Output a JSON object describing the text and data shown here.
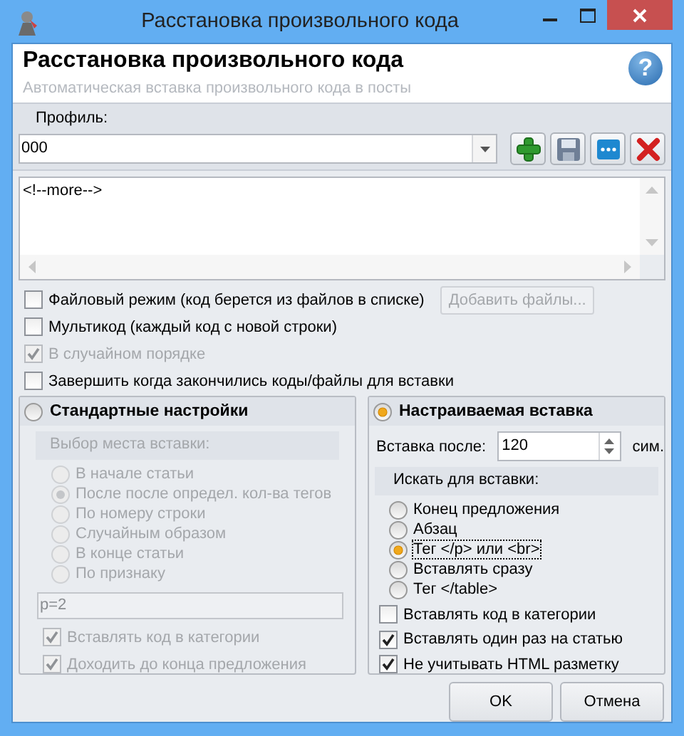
{
  "window": {
    "title": "Расстановка произвольного кода"
  },
  "header": {
    "title": "Расстановка произвольного кода",
    "subtitle": "Автоматическая вставка произвольного кода в посты",
    "help": "?"
  },
  "profile": {
    "label": "Профиль:",
    "value": "000",
    "buttons": [
      {
        "kind": "add"
      },
      {
        "kind": "save"
      },
      {
        "kind": "more"
      },
      {
        "kind": "delete"
      }
    ]
  },
  "code_editor": {
    "text": "<!--more-->"
  },
  "options": [
    {
      "label": "Файловый режим (код берется из файлов в списке)",
      "checked": false,
      "disabled": false,
      "button": {
        "label": "Добавить файлы...",
        "disabled": true
      }
    },
    {
      "label": "Мультикод (каждый код с новой строки)",
      "checked": false,
      "disabled": false
    },
    {
      "label": "В случайном порядке",
      "checked": true,
      "disabled": true
    },
    {
      "label": "Завершить когда закончились коды/файлы для вставки",
      "checked": false,
      "disabled": false
    }
  ],
  "standard": {
    "title": "Стандартные настройки",
    "selected": false,
    "disabled": true,
    "section_label": "Выбор места вставки:",
    "choices": [
      {
        "label": "В начале статьи",
        "selected": false
      },
      {
        "label": "После после определ. кол-ва тегов",
        "selected": true
      },
      {
        "label": "По номеру строки",
        "selected": false
      },
      {
        "label": "Случайным образом",
        "selected": false
      },
      {
        "label": "В конце статьи",
        "selected": false
      },
      {
        "label": "По признаку",
        "selected": false
      }
    ],
    "field_value": "p=2",
    "options": [
      {
        "label": "Вставлять код в категории",
        "checked": true
      },
      {
        "label": "Доходить до конца предложения",
        "checked": true
      }
    ]
  },
  "custom": {
    "title": "Настраиваемая вставка",
    "selected": true,
    "disabled": false,
    "insert_after_label": "Вставка после:",
    "insert_after_value": "120",
    "unit": "сим.",
    "section_label": "Искать для вставки:",
    "choices": [
      {
        "label": "Конец предложения",
        "selected": false,
        "focused": false
      },
      {
        "label": "Абзац",
        "selected": false,
        "focused": false
      },
      {
        "label": "Тег </p> или <br>",
        "selected": true,
        "focused": true
      },
      {
        "label": "Вставлять сразу",
        "selected": false,
        "focused": false
      },
      {
        "label": "Тег </table>",
        "selected": false,
        "focused": false
      }
    ],
    "options": [
      {
        "label": "Вставлять код в категории",
        "checked": false
      },
      {
        "label": "Вставлять один раз на статью",
        "checked": true
      },
      {
        "label": "Не учитывать HTML разметку",
        "checked": true
      }
    ]
  },
  "buttons": [
    {
      "label": "OK"
    },
    {
      "label": "Отмена"
    }
  ]
}
